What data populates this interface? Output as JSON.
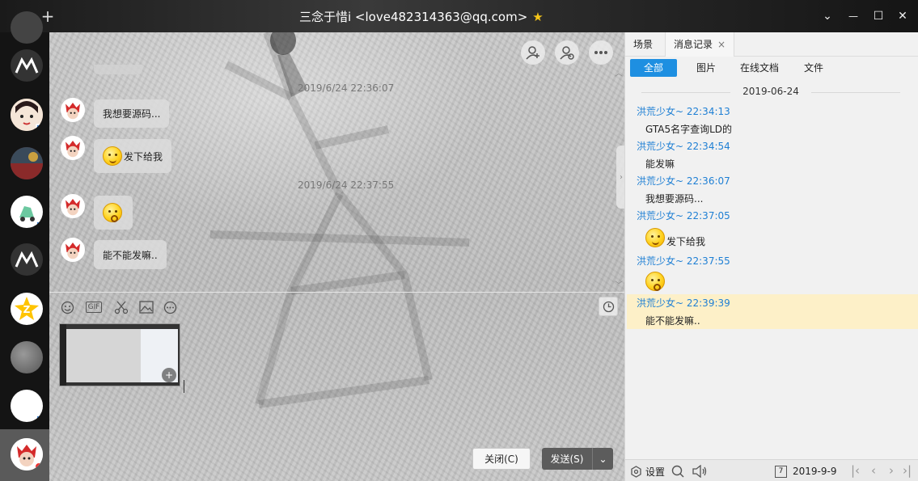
{
  "window": {
    "title": "三念于惜i <love482314363@qq.com>",
    "star": "★"
  },
  "titlebar_icons": {
    "search": "⌕",
    "add": "+"
  },
  "window_controls": {
    "dropdown": "⌄",
    "minimize": "—",
    "maximize": "☐",
    "close": "✕"
  },
  "chat": {
    "messages": [
      {
        "type": "timestamp",
        "text": "2019/6/24 22:36:07"
      },
      {
        "type": "text",
        "text": "我想要源码..."
      },
      {
        "type": "emoji_text",
        "emoji": "smile",
        "text": "发下给我"
      },
      {
        "type": "timestamp",
        "text": "2019/6/24 22:37:55"
      },
      {
        "type": "emoji",
        "emoji": "confused"
      },
      {
        "type": "text",
        "text": "能不能发嘛.."
      }
    ],
    "toolbar_gif": "GIF"
  },
  "buttons": {
    "close": "关闭(C)",
    "send": "发送(S)",
    "send_dropdown": "⌄"
  },
  "history": {
    "tabs": [
      {
        "label": "场景"
      },
      {
        "label": "消息记录",
        "close": "×"
      }
    ],
    "filters": [
      "全部",
      "图片",
      "在线文档",
      "文件"
    ],
    "date": "2019-06-24",
    "entries": [
      {
        "sender": "洪荒少女~ 22:34:13",
        "text": "GTA5名字查询LD的"
      },
      {
        "sender": "洪荒少女~ 22:34:54",
        "text": "能发嘛"
      },
      {
        "sender": "洪荒少女~ 22:36:07",
        "text": "我想要源码..."
      },
      {
        "sender": "洪荒少女~ 22:37:05",
        "text": "发下给我",
        "emoji": "smile"
      },
      {
        "sender": "洪荒少女~ 22:37:55",
        "text": "",
        "emoji": "confused"
      },
      {
        "sender": "洪荒少女~ 22:39:39",
        "text": "能不能发嘛..",
        "highlighted": true
      }
    ],
    "footer": {
      "settings": "设置",
      "date": "2019-9-9",
      "calendar_day": "7"
    }
  },
  "colors": {
    "accent": "#1e8fe1",
    "sender_name": "#1e7fd4",
    "highlight": "#fdf0c8",
    "send_button": "#5c5c5c",
    "rail": "#141414"
  }
}
